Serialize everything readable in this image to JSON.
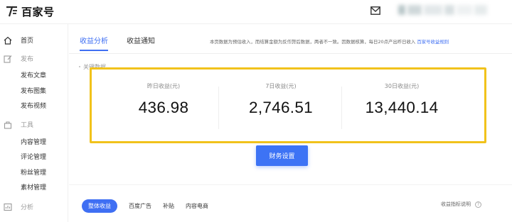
{
  "header": {
    "brand": "百家号",
    "mail_icon": "mail-icon"
  },
  "sidebar": {
    "home": "首页",
    "publish_section": "发布",
    "publish_items": [
      "发布文章",
      "发布图集",
      "发布视频"
    ],
    "tools_section": "工具",
    "tools_items": [
      "内容管理",
      "评论管理",
      "粉丝管理",
      "素材管理"
    ],
    "analysis": "分析"
  },
  "main": {
    "tabs": [
      {
        "label": "收益分析",
        "active": true
      },
      {
        "label": "收益通知",
        "active": false
      }
    ],
    "notice": "本页数据为预估收入，而结算金额为反作弊后数据，两者不一致。因数据核算，每日20点产出昨日收入",
    "notice_link": "百家号收益规则",
    "section_title": "关键数据",
    "stats": [
      {
        "label": "昨日收益(元)",
        "value": "436.98"
      },
      {
        "label": "7日收益(元)",
        "value": "2,746.51"
      },
      {
        "label": "30日收益(元)",
        "value": "13,440.14"
      }
    ],
    "finance_button": "财务设置",
    "subtabs": [
      {
        "label": "整体收益",
        "active": true
      },
      {
        "label": "百度广告",
        "active": false
      },
      {
        "label": "补贴",
        "active": false
      },
      {
        "label": "内容电商",
        "active": false
      }
    ],
    "help_label": "收益指标说明",
    "help_mark": "?"
  },
  "colors": {
    "accent": "#3f6ff3",
    "highlight": "#f1c21b",
    "button": "#3d73f5"
  }
}
